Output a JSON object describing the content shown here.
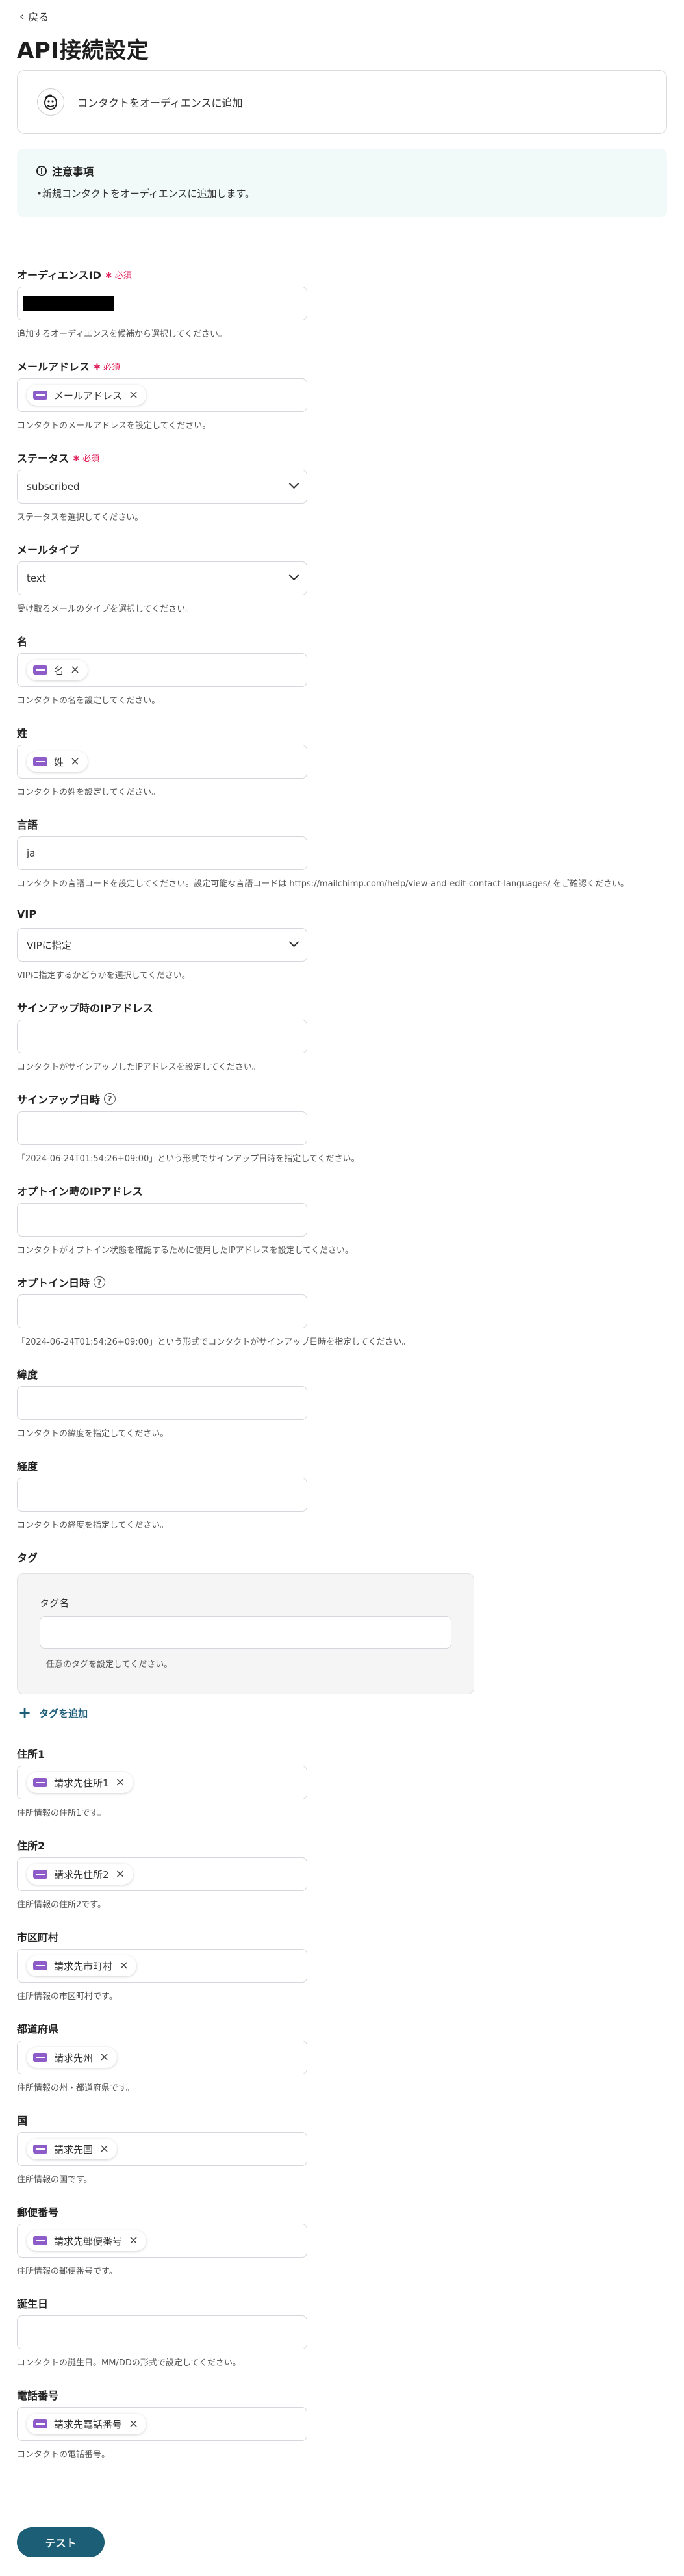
{
  "header": {
    "back_label": "戻る",
    "title": "API接続設定"
  },
  "app": {
    "label": "コンタクトをオーディエンスに追加",
    "icon": "mailchimp-logo"
  },
  "notice": {
    "title": "注意事項",
    "body": "•新規コンタクトをオーディエンスに追加します。"
  },
  "fields": {
    "audience_id": {
      "label": "オーディエンスID",
      "required": "必須",
      "hint": "追加するオーディエンスを候補から選択してください。"
    },
    "email": {
      "label": "メールアドレス",
      "required": "必須",
      "chip": "メールアドレス",
      "hint": "コンタクトのメールアドレスを設定してください。"
    },
    "status": {
      "label": "ステータス",
      "required": "必須",
      "value": "subscribed",
      "hint": "ステータスを選択してください。"
    },
    "email_type": {
      "label": "メールタイプ",
      "value": "text",
      "hint": "受け取るメールのタイプを選択してください。"
    },
    "first_name": {
      "label": "名",
      "chip": "名",
      "hint": "コンタクトの名を設定してください。"
    },
    "last_name": {
      "label": "姓",
      "chip": "姓",
      "hint": "コンタクトの姓を設定してください。"
    },
    "language": {
      "label": "言語",
      "value": "ja",
      "hint": "コンタクトの言語コードを設定してください。設定可能な言語コードは https://mailchimp.com/help/view-and-edit-contact-languages/ をご確認ください。"
    },
    "vip": {
      "label": "VIP",
      "value": "VIPに指定",
      "hint": "VIPに指定するかどうかを選択してください。"
    },
    "signup_ip": {
      "label": "サインアップ時のIPアドレス",
      "hint": "コンタクトがサインアップしたIPアドレスを設定してください。"
    },
    "signup_date": {
      "label": "サインアップ日時",
      "hint": "「2024-06-24T01:54:26+09:00」という形式でサインアップ日時を指定してください。"
    },
    "optin_ip": {
      "label": "オプトイン時のIPアドレス",
      "hint": "コンタクトがオプトイン状態を確認するために使用したIPアドレスを設定してください。"
    },
    "optin_date": {
      "label": "オプトイン日時",
      "hint": "「2024-06-24T01:54:26+09:00」という形式でコンタクトがサインアップ日時を指定してください。"
    },
    "latitude": {
      "label": "緯度",
      "hint": "コンタクトの緯度を指定してください。"
    },
    "longitude": {
      "label": "経度",
      "hint": "コンタクトの経度を指定してください。"
    },
    "tags": {
      "label": "タグ",
      "inner_label": "タグ名",
      "inner_hint": "任意のタグを設定してください。",
      "add_label": "タグを追加"
    },
    "address1": {
      "label": "住所1",
      "chip": "請求先住所1",
      "hint": "住所情報の住所1です。"
    },
    "address2": {
      "label": "住所2",
      "chip": "請求先住所2",
      "hint": "住所情報の住所2です。"
    },
    "city": {
      "label": "市区町村",
      "chip": "請求先市町村",
      "hint": "住所情報の市区町村です。"
    },
    "state": {
      "label": "都道府県",
      "chip": "請求先州",
      "hint": "住所情報の州・都道府県です。"
    },
    "country": {
      "label": "国",
      "chip": "請求先国",
      "hint": "住所情報の国です。"
    },
    "zip": {
      "label": "郵便番号",
      "chip": "請求先郵便番号",
      "hint": "住所情報の郵便番号です。"
    },
    "birthday": {
      "label": "誕生日",
      "hint": "コンタクトの誕生日。MM/DDの形式で設定してください。"
    },
    "phone": {
      "label": "電話番号",
      "chip": "請求先電話番号",
      "hint": "コンタクトの電話番号。"
    }
  },
  "test_button": "テスト"
}
